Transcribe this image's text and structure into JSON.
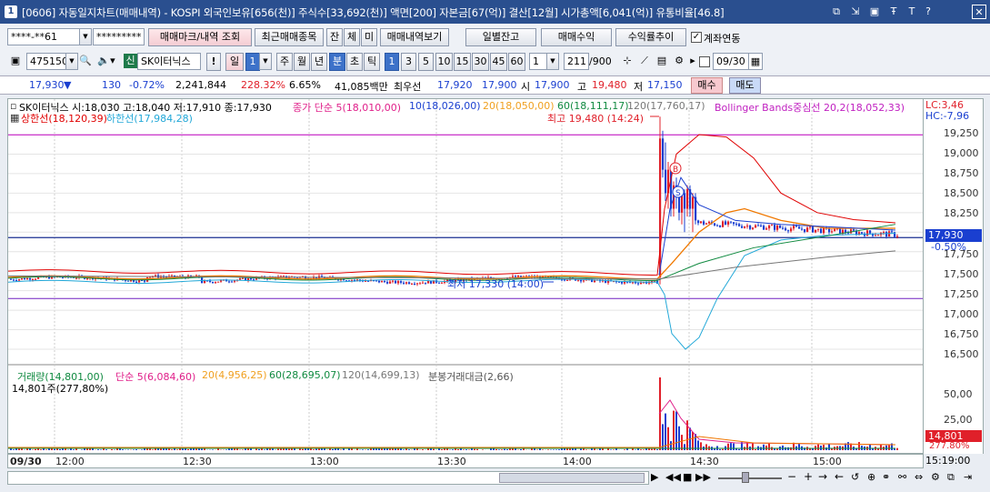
{
  "window": {
    "number": "1",
    "title": "[0606] 자동일지차트(매매내역) - KOSPI 외국인보유[656(천)] 주식수[33,692(천)] 액면[200] 자본금[67(억)] 결산[12월] 시가총액[6,041(억)] 유통비율[46.8]",
    "icons": [
      "restore-icon",
      "pin-icon",
      "tile-icon",
      "font-size-icon",
      "pin-top-icon",
      "text-icon",
      "help-icon",
      "close-icon"
    ],
    "icon_glyphs": [
      "⧉",
      "⇲",
      "▣",
      "ㅌ",
      "Ŧ",
      "T",
      "?",
      "✕"
    ]
  },
  "toolbar1": {
    "account": "****-**61",
    "password": "*********",
    "btn_trade_mark": "매매마크/내역 조회",
    "btn_recent": "최근매매종목",
    "btn_jan": "잔",
    "btn_che": "체",
    "btn_mi": "미",
    "btn_view": "매매내역보기",
    "btn_daily": "일별잔고",
    "btn_profit": "매매수익",
    "btn_return": "수익률추이",
    "chk_linked": "계좌연동"
  },
  "toolbar2": {
    "code": "475150",
    "badge": "신",
    "stock_name": "SK이터닉스",
    "periods": [
      "일",
      "1",
      "주",
      "월",
      "년",
      "분",
      "초",
      "틱"
    ],
    "intervals": [
      "1",
      "3",
      "5",
      "10",
      "15",
      "30",
      "45",
      "60"
    ],
    "count_sel": "1",
    "count": "211",
    "count_max": "/900",
    "date": "09/30",
    "excl": "!"
  },
  "quote": {
    "price": "17,930",
    "arrow": "▼",
    "change": "130",
    "pct": "-0.72%",
    "volume": "2,241,844",
    "vol_ratio": "228.32%",
    "turnover": "6.65%",
    "amount": "41,085백만",
    "label_bid": "최우선",
    "bid": "17,920",
    "ask": "17,900",
    "label_open": "시",
    "open": "17,900",
    "label_high": "고",
    "high": "19,480",
    "label_low": "저",
    "low": "17,150",
    "buy": "매수",
    "sell": "매도"
  },
  "price_legend": {
    "stock": "SK이터닉스 시:18,030 고:18,040 저:17,910 종:17,930",
    "ma": "종가 단순 5(18,010,00)",
    "ma10": "10(18,026,00)",
    "ma20": "20(18,050,00)",
    "ma60": "60(18,111,17)",
    "ma120": "120(17,760,17)",
    "bb": "Bollinger Bands중심선 20,2(18,052,33)",
    "upper": "상한선(18,120,39)",
    "lower": "하한선(17,984,28)",
    "max_label": "최고 19,480 (14:24)",
    "min_label": "최저 17,330 (14:00)",
    "lc": "LC:3,46",
    "hc": "HC:-7,96",
    "cur_price": "17,930",
    "cur_pct": "-0.50%"
  },
  "y_ticks": [
    "19,250",
    "19,000",
    "18,750",
    "18,500",
    "18,250",
    "18,000",
    "17,750",
    "17,500",
    "17,250",
    "17,000",
    "16,750",
    "16,500"
  ],
  "vol_legend": {
    "vol": "거래량(14,801,00)",
    "ma": "단순 5(6,084,60)",
    "ma20": "20(4,956,25)",
    "ma60": "60(28,695,07)",
    "ma120": "120(14,699,13)",
    "amt": "분봉거래대금(2,66)",
    "cur": "14,801주(277,80%)",
    "cur_box": "14,801",
    "cur_pct": "277.80%"
  },
  "vol_ticks": [
    "50,00",
    "25,00"
  ],
  "x_axis": {
    "date": "09/30",
    "times": [
      "12:00",
      "12:30",
      "13:00",
      "13:30",
      "14:00",
      "14:30",
      "15:00"
    ],
    "right": "15:19:00"
  },
  "marks": {
    "buy": "B",
    "sell": "S"
  },
  "colors": {
    "titlebar": "#2a4f8f",
    "up": "#e0202a",
    "down": "#1a3fd0",
    "bb_upper": "#e00000",
    "bb_lower": "#22a8d8"
  }
}
